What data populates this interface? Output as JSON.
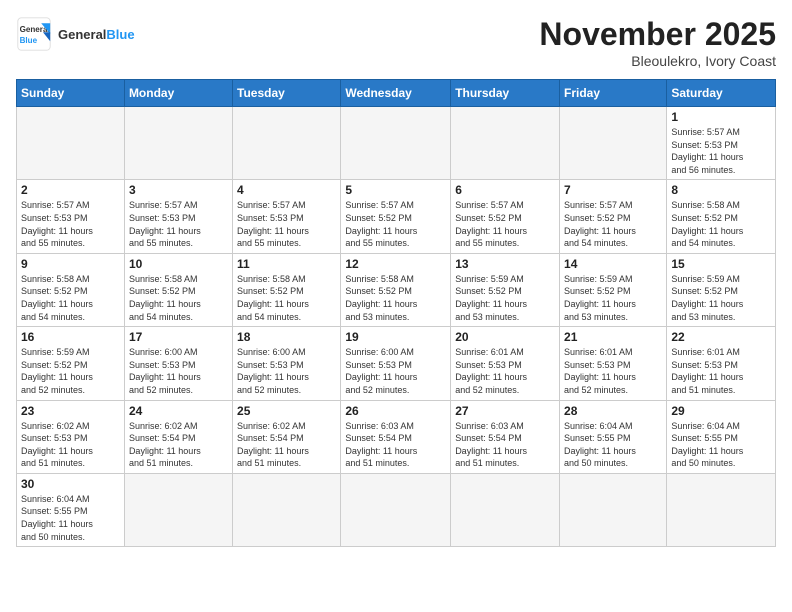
{
  "header": {
    "logo_general": "General",
    "logo_blue": "Blue",
    "month": "November 2025",
    "location": "Bleoulekro, Ivory Coast"
  },
  "weekdays": [
    "Sunday",
    "Monday",
    "Tuesday",
    "Wednesday",
    "Thursday",
    "Friday",
    "Saturday"
  ],
  "weeks": [
    [
      {
        "day": "",
        "info": ""
      },
      {
        "day": "",
        "info": ""
      },
      {
        "day": "",
        "info": ""
      },
      {
        "day": "",
        "info": ""
      },
      {
        "day": "",
        "info": ""
      },
      {
        "day": "",
        "info": ""
      },
      {
        "day": "1",
        "info": "Sunrise: 5:57 AM\nSunset: 5:53 PM\nDaylight: 11 hours\nand 56 minutes."
      }
    ],
    [
      {
        "day": "2",
        "info": "Sunrise: 5:57 AM\nSunset: 5:53 PM\nDaylight: 11 hours\nand 55 minutes."
      },
      {
        "day": "3",
        "info": "Sunrise: 5:57 AM\nSunset: 5:53 PM\nDaylight: 11 hours\nand 55 minutes."
      },
      {
        "day": "4",
        "info": "Sunrise: 5:57 AM\nSunset: 5:53 PM\nDaylight: 11 hours\nand 55 minutes."
      },
      {
        "day": "5",
        "info": "Sunrise: 5:57 AM\nSunset: 5:52 PM\nDaylight: 11 hours\nand 55 minutes."
      },
      {
        "day": "6",
        "info": "Sunrise: 5:57 AM\nSunset: 5:52 PM\nDaylight: 11 hours\nand 55 minutes."
      },
      {
        "day": "7",
        "info": "Sunrise: 5:57 AM\nSunset: 5:52 PM\nDaylight: 11 hours\nand 54 minutes."
      },
      {
        "day": "8",
        "info": "Sunrise: 5:58 AM\nSunset: 5:52 PM\nDaylight: 11 hours\nand 54 minutes."
      }
    ],
    [
      {
        "day": "9",
        "info": "Sunrise: 5:58 AM\nSunset: 5:52 PM\nDaylight: 11 hours\nand 54 minutes."
      },
      {
        "day": "10",
        "info": "Sunrise: 5:58 AM\nSunset: 5:52 PM\nDaylight: 11 hours\nand 54 minutes."
      },
      {
        "day": "11",
        "info": "Sunrise: 5:58 AM\nSunset: 5:52 PM\nDaylight: 11 hours\nand 54 minutes."
      },
      {
        "day": "12",
        "info": "Sunrise: 5:58 AM\nSunset: 5:52 PM\nDaylight: 11 hours\nand 53 minutes."
      },
      {
        "day": "13",
        "info": "Sunrise: 5:59 AM\nSunset: 5:52 PM\nDaylight: 11 hours\nand 53 minutes."
      },
      {
        "day": "14",
        "info": "Sunrise: 5:59 AM\nSunset: 5:52 PM\nDaylight: 11 hours\nand 53 minutes."
      },
      {
        "day": "15",
        "info": "Sunrise: 5:59 AM\nSunset: 5:52 PM\nDaylight: 11 hours\nand 53 minutes."
      }
    ],
    [
      {
        "day": "16",
        "info": "Sunrise: 5:59 AM\nSunset: 5:52 PM\nDaylight: 11 hours\nand 52 minutes."
      },
      {
        "day": "17",
        "info": "Sunrise: 6:00 AM\nSunset: 5:53 PM\nDaylight: 11 hours\nand 52 minutes."
      },
      {
        "day": "18",
        "info": "Sunrise: 6:00 AM\nSunset: 5:53 PM\nDaylight: 11 hours\nand 52 minutes."
      },
      {
        "day": "19",
        "info": "Sunrise: 6:00 AM\nSunset: 5:53 PM\nDaylight: 11 hours\nand 52 minutes."
      },
      {
        "day": "20",
        "info": "Sunrise: 6:01 AM\nSunset: 5:53 PM\nDaylight: 11 hours\nand 52 minutes."
      },
      {
        "day": "21",
        "info": "Sunrise: 6:01 AM\nSunset: 5:53 PM\nDaylight: 11 hours\nand 52 minutes."
      },
      {
        "day": "22",
        "info": "Sunrise: 6:01 AM\nSunset: 5:53 PM\nDaylight: 11 hours\nand 51 minutes."
      }
    ],
    [
      {
        "day": "23",
        "info": "Sunrise: 6:02 AM\nSunset: 5:53 PM\nDaylight: 11 hours\nand 51 minutes."
      },
      {
        "day": "24",
        "info": "Sunrise: 6:02 AM\nSunset: 5:54 PM\nDaylight: 11 hours\nand 51 minutes."
      },
      {
        "day": "25",
        "info": "Sunrise: 6:02 AM\nSunset: 5:54 PM\nDaylight: 11 hours\nand 51 minutes."
      },
      {
        "day": "26",
        "info": "Sunrise: 6:03 AM\nSunset: 5:54 PM\nDaylight: 11 hours\nand 51 minutes."
      },
      {
        "day": "27",
        "info": "Sunrise: 6:03 AM\nSunset: 5:54 PM\nDaylight: 11 hours\nand 51 minutes."
      },
      {
        "day": "28",
        "info": "Sunrise: 6:04 AM\nSunset: 5:55 PM\nDaylight: 11 hours\nand 50 minutes."
      },
      {
        "day": "29",
        "info": "Sunrise: 6:04 AM\nSunset: 5:55 PM\nDaylight: 11 hours\nand 50 minutes."
      }
    ],
    [
      {
        "day": "30",
        "info": "Sunrise: 6:04 AM\nSunset: 5:55 PM\nDaylight: 11 hours\nand 50 minutes."
      },
      {
        "day": "",
        "info": ""
      },
      {
        "day": "",
        "info": ""
      },
      {
        "day": "",
        "info": ""
      },
      {
        "day": "",
        "info": ""
      },
      {
        "day": "",
        "info": ""
      },
      {
        "day": "",
        "info": ""
      }
    ]
  ]
}
